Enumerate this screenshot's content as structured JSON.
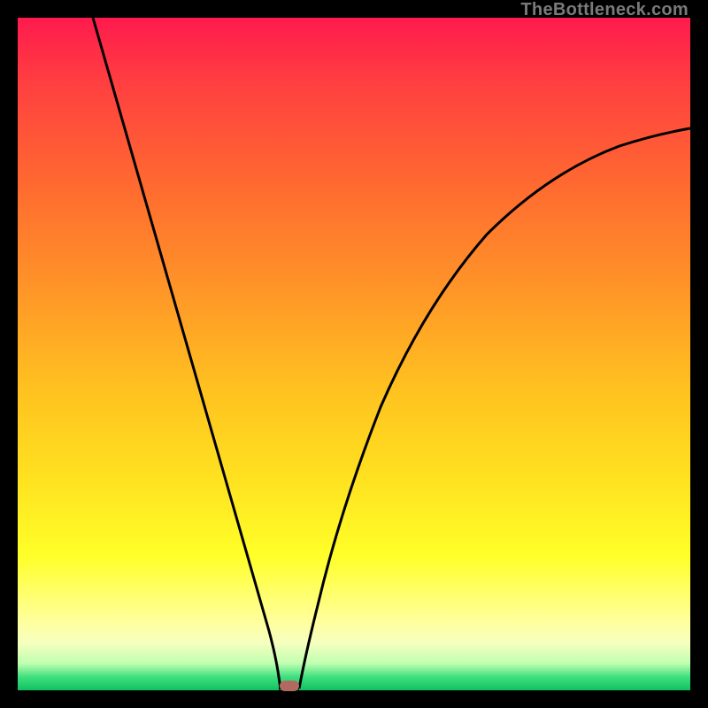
{
  "watermark": "TheBottleneck.com",
  "colors": {
    "frame": "#000000",
    "gradient_top": "#ff1a4d",
    "gradient_mid": "#ffff28",
    "gradient_bottom": "#10c060",
    "curve": "#000000",
    "marker": "#b26a60"
  },
  "chart_data": {
    "type": "line",
    "title": "",
    "xlabel": "",
    "ylabel": "",
    "xlim": [
      0,
      100
    ],
    "ylim": [
      0,
      100
    ],
    "grid": false,
    "series": [
      {
        "name": "left-branch",
        "x": [
          11,
          15,
          20,
          25,
          30,
          35,
          37,
          38,
          38.5
        ],
        "values": [
          100,
          86,
          69,
          52,
          35,
          17,
          7,
          2,
          0
        ]
      },
      {
        "name": "right-branch",
        "x": [
          41,
          43,
          46,
          50,
          55,
          60,
          65,
          70,
          75,
          80,
          85,
          90,
          95,
          100
        ],
        "values": [
          0,
          10,
          23,
          37,
          51,
          61,
          68,
          73,
          76.5,
          79,
          81,
          82.5,
          83.5,
          84
        ]
      }
    ],
    "annotations": [
      {
        "name": "min-marker",
        "x": 40,
        "y": 0
      }
    ]
  }
}
